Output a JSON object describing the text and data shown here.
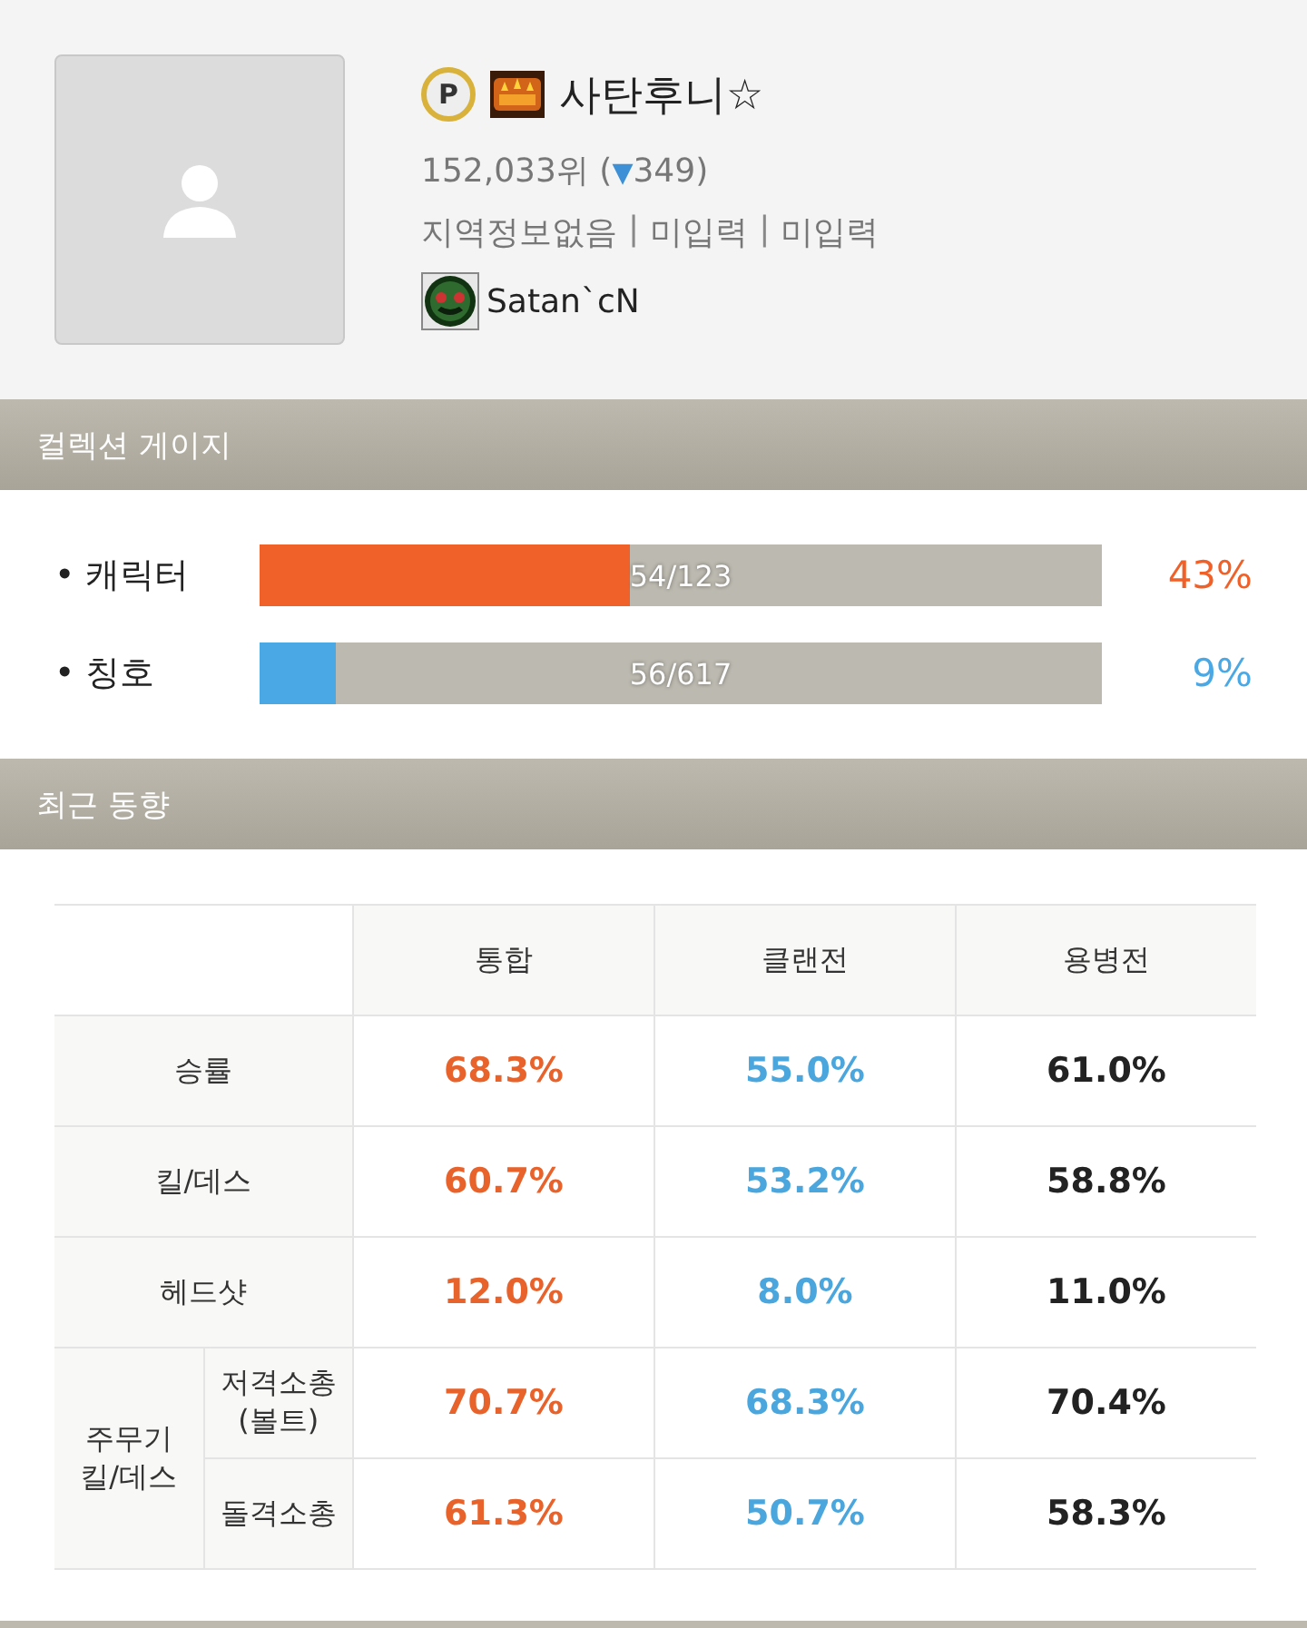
{
  "profile": {
    "badge_letter": "P",
    "nickname": "사탄후니☆",
    "rank_text": "152,033위 (",
    "change_arrow": "▼",
    "change_text": "349)",
    "location": [
      "지역정보없음",
      "미입력",
      "미입력"
    ],
    "separator": "|",
    "clan": "Satan`cN"
  },
  "collection": {
    "title": "컬렉션 게이지",
    "bullet": "•",
    "gauges": [
      {
        "label": "캐릭터",
        "count": "54/123",
        "level": 0.439,
        "percent": "43%",
        "color": "#f0612a"
      },
      {
        "label": "칭호",
        "count": "56/617",
        "level": 0.09,
        "percent": "9%",
        "color": "#4aa8e4"
      }
    ]
  },
  "recent": {
    "title": "최근 동향",
    "columns": [
      {
        "label": "통합",
        "color": "#e8622c"
      },
      {
        "label": "클랜전",
        "color": "#4aa6dc"
      },
      {
        "label": "용병전",
        "color": "#222222"
      }
    ],
    "rows": [
      {
        "label": "승률",
        "values": [
          "68.3%",
          "55.0%",
          "61.0%"
        ]
      },
      {
        "label": "킬/데스",
        "values": [
          "60.7%",
          "53.2%",
          "58.8%"
        ]
      },
      {
        "label": "헤드샷",
        "values": [
          "12.0%",
          "8.0%",
          "11.0%"
        ]
      }
    ],
    "group": {
      "label": "주무기\n킬/데스",
      "rows": [
        {
          "label": "저격소총\n(볼트)",
          "values": [
            "70.7%",
            "68.3%",
            "70.4%"
          ]
        },
        {
          "label": "돌격소총",
          "values": [
            "61.3%",
            "50.7%",
            "58.3%"
          ]
        }
      ]
    }
  }
}
